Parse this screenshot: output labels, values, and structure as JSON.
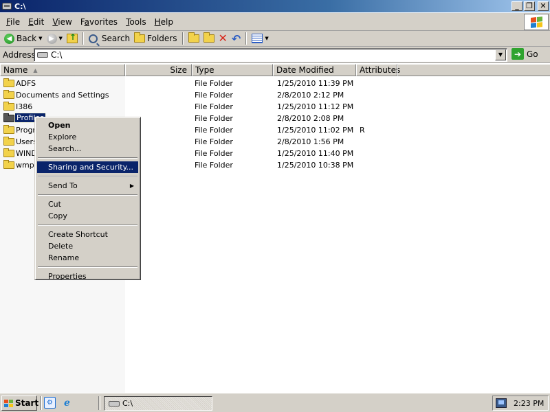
{
  "window": {
    "title": "C:\\",
    "buttons": {
      "minimize": "_",
      "maximize": "❐",
      "close": "✕"
    }
  },
  "menubar": {
    "items": [
      {
        "label": "File",
        "accel": "F",
        "rest": "ile"
      },
      {
        "label": "Edit",
        "accel": "E",
        "rest": "dit"
      },
      {
        "label": "View",
        "accel": "V",
        "rest": "iew"
      },
      {
        "label": "Favorites",
        "accel": "a",
        "pre": "F",
        "rest": "vorites"
      },
      {
        "label": "Tools",
        "accel": "T",
        "rest": "ools"
      },
      {
        "label": "Help",
        "accel": "H",
        "rest": "elp"
      }
    ]
  },
  "toolbar": {
    "back_label": "Back",
    "search_label": "Search",
    "folders_label": "Folders"
  },
  "address": {
    "label": "Address",
    "value": "C:\\",
    "go_label": "Go"
  },
  "columns": [
    "Name",
    "Size",
    "Type",
    "Date Modified",
    "Attributes"
  ],
  "files": [
    {
      "name": "ADFS",
      "type": "File Folder",
      "date": "1/25/2010 11:39 PM",
      "attr": ""
    },
    {
      "name": "Documents and Settings",
      "type": "File Folder",
      "date": "2/8/2010 2:12 PM",
      "attr": ""
    },
    {
      "name": "I386",
      "type": "File Folder",
      "date": "1/25/2010 11:12 PM",
      "attr": ""
    },
    {
      "name": "Profiles",
      "type": "File Folder",
      "date": "2/8/2010 2:08 PM",
      "attr": ""
    },
    {
      "name": "Progr",
      "type": "File Folder",
      "date": "1/25/2010 11:02 PM",
      "attr": "R"
    },
    {
      "name": "Users",
      "type": "File Folder",
      "date": "2/8/2010 1:56 PM",
      "attr": ""
    },
    {
      "name": "WIND",
      "type": "File Folder",
      "date": "1/25/2010 11:40 PM",
      "attr": ""
    },
    {
      "name": "wmpu",
      "type": "File Folder",
      "date": "1/25/2010 10:38 PM",
      "attr": ""
    }
  ],
  "context_menu": {
    "items": [
      {
        "label": "Open"
      },
      {
        "label": "Explore"
      },
      {
        "label": "Search..."
      },
      {
        "label": "Sharing and Security..."
      },
      {
        "label": "Send To"
      },
      {
        "label": "Cut"
      },
      {
        "label": "Copy"
      },
      {
        "label": "Create Shortcut"
      },
      {
        "label": "Delete"
      },
      {
        "label": "Rename"
      },
      {
        "label": "Properties"
      }
    ]
  },
  "taskbar": {
    "start_label": "Start",
    "task_label": "C:\\",
    "clock": "2:23 PM"
  },
  "colors": {
    "selection": "#0a246a",
    "chrome": "#d4d0c8"
  }
}
